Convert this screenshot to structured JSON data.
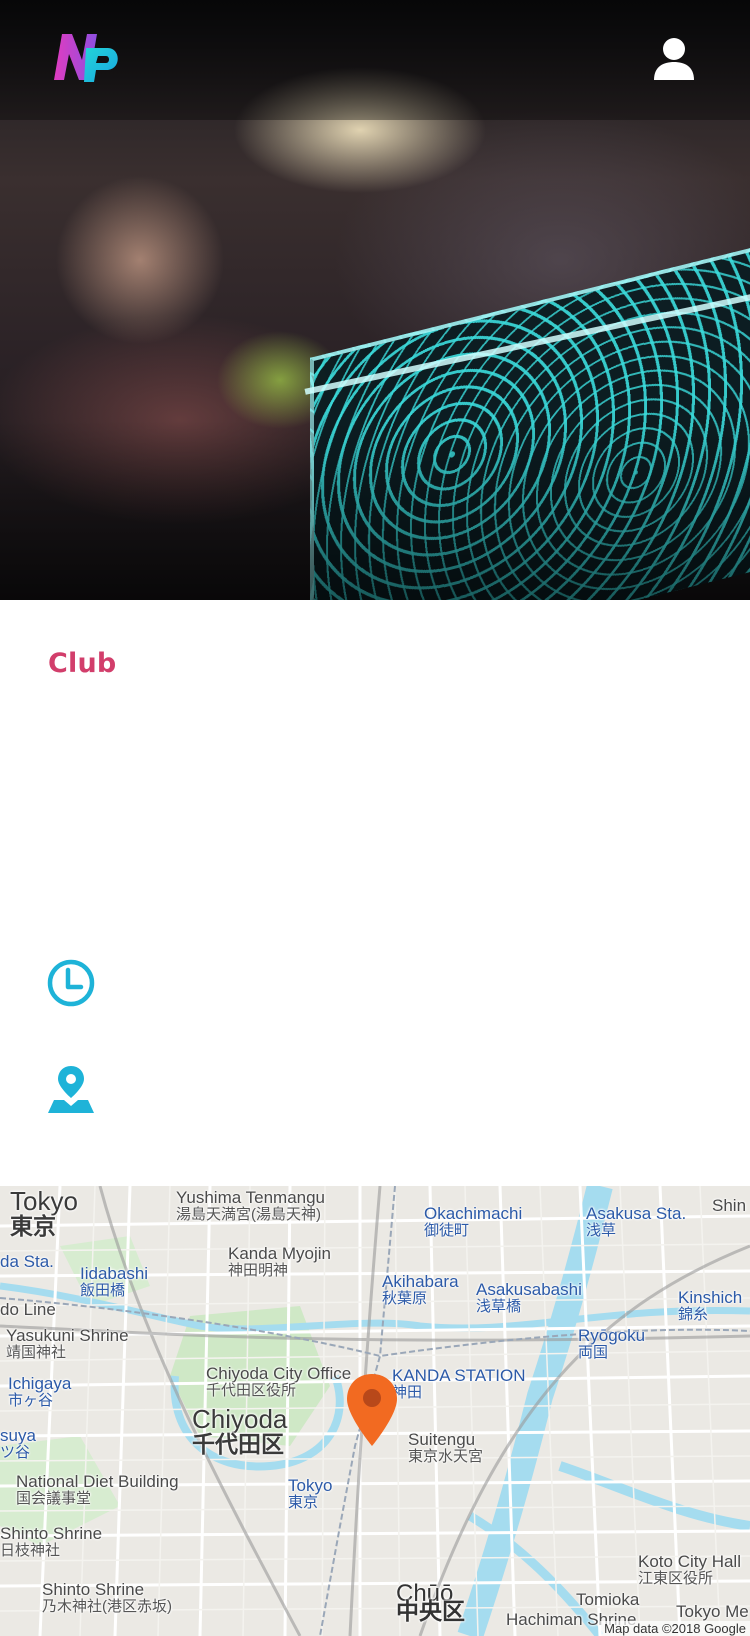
{
  "header": {
    "logo_text": "NP"
  },
  "venue": {
    "category": "Club",
    "time": "",
    "address": ""
  },
  "map": {
    "labels": [
      {
        "en": "Tokyo",
        "ja": "東京"
      },
      {
        "en": "Yushima Tenmangu",
        "ja": "湯島天満宮(湯島天神)"
      },
      {
        "en": "Okachimachi",
        "ja": "御徒町"
      },
      {
        "en": "Asakusa Sta.",
        "ja": "浅草"
      },
      {
        "en": "Shin"
      },
      {
        "en": "da Sta."
      },
      {
        "en": "Iidabashi",
        "ja": "飯田橋"
      },
      {
        "en": "Kanda Myojin",
        "ja": "神田明神"
      },
      {
        "en": "Akihabara",
        "ja": "秋葉原"
      },
      {
        "en": "Asakusabashi",
        "ja": "浅草橋"
      },
      {
        "en": "Kinshich",
        "ja": "錦糸"
      },
      {
        "en": "do Line"
      },
      {
        "en": "Yasukuni Shrine",
        "ja": "靖国神社"
      },
      {
        "en": "Ryōgoku",
        "ja": "両国"
      },
      {
        "en": "Ichigaya",
        "ja": "市ヶ谷"
      },
      {
        "en": "Chiyoda City Office",
        "ja": "千代田区役所"
      },
      {
        "en": "KANDA STATION",
        "ja": "神田"
      },
      {
        "en": "Chiyoda",
        "ja": "千代田区"
      },
      {
        "en": "Suitengu",
        "ja": "東京水天宮"
      },
      {
        "en": "suya",
        "ja": "ツ谷"
      },
      {
        "en": "National Diet Building",
        "ja": "国会議事堂"
      },
      {
        "en": "Tokyo",
        "ja": "東京"
      },
      {
        "en": "Shinto Shrine",
        "ja": "日枝神社"
      },
      {
        "en": "Koto City Hall",
        "ja": "江東区役所"
      },
      {
        "en": "Shinto Shrine",
        "ja": "乃木神社(港区赤坂)"
      },
      {
        "en": "Chūō",
        "ja": "中央区"
      },
      {
        "en": "Tomioka"
      },
      {
        "en": "Hachiman Shrine"
      },
      {
        "en": "Tokyo Me"
      }
    ],
    "credit": "Map data ©2018 Google"
  },
  "colors": {
    "accent_pink": "#d23e6b",
    "accent_teal": "#1eb3d8",
    "pin_orange": "#f26a21"
  }
}
